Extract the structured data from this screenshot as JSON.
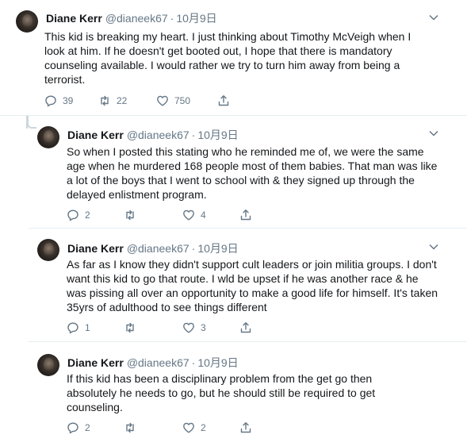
{
  "tweets": [
    {
      "name": "Diane Kerr",
      "handle": "@dianeek67",
      "dot": "·",
      "date": "10月9日",
      "text": "This kid is breaking my heart. I just thinking about Timothy McVeigh when I look at him. If he doesn't get booted out, I hope that there is mandatory counseling available. I would rather we try to turn him away from being a terrorist.",
      "replies": "39",
      "retweets": "22",
      "likes": "750"
    },
    {
      "name": "Diane Kerr",
      "handle": "@dianeek67",
      "dot": "·",
      "date": "10月9日",
      "text": "So when I posted this stating who he reminded me of, we were the same age when he murdered 168 people most of them babies. That man was like a lot of the boys that I went to school with & they signed up through the delayed enlistment program.",
      "replies": "2",
      "retweets": "",
      "likes": "4"
    },
    {
      "name": "Diane Kerr",
      "handle": "@dianeek67",
      "dot": "·",
      "date": "10月9日",
      "text": "As far as I know they didn't support cult leaders or join militia groups. I don't want this kid to go that route. I wld be upset if he was another race & he was pissing all over an opportunity to make a good life for himself. It's taken 35yrs of adulthood to see things different",
      "replies": "1",
      "retweets": "",
      "likes": "3"
    },
    {
      "name": "Diane Kerr",
      "handle": "@dianeek67",
      "dot": "·",
      "date": "10月9日",
      "text": "If this kid has been a disciplinary problem from the get go then absolutely he needs to go, but he should still be required to get counseling.",
      "replies": "2",
      "retweets": "",
      "likes": "2"
    }
  ],
  "icons": {
    "reply": "reply-icon",
    "retweet": "retweet-icon",
    "like": "heart-icon",
    "share": "share-icon",
    "more": "chevron-down-icon"
  },
  "colors": {
    "text": "#14171a",
    "muted": "#657786",
    "divider": "#e6ecf0"
  }
}
